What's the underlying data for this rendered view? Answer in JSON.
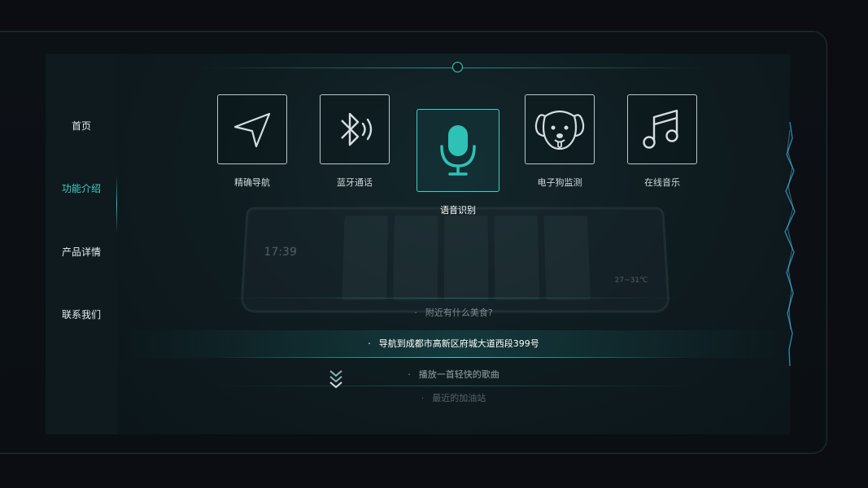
{
  "sidebar": {
    "items": [
      {
        "label": "首页"
      },
      {
        "label": "功能介绍",
        "active": true
      },
      {
        "label": "产品详情"
      },
      {
        "label": "联系我们"
      }
    ]
  },
  "features": [
    {
      "label": "精确导航",
      "icon": "navigation-arrow-icon"
    },
    {
      "label": "蓝牙通话",
      "icon": "bluetooth-call-icon"
    },
    {
      "label": "语音识别",
      "icon": "microphone-icon",
      "active": true
    },
    {
      "label": "电子狗监测",
      "icon": "dog-icon"
    },
    {
      "label": "在线音乐",
      "icon": "music-note-icon"
    }
  ],
  "prompts": [
    {
      "text": "附近有什么美食?"
    },
    {
      "text": "导航到成都市高新区府城大道西段399号",
      "highlighted": true
    },
    {
      "text": "播放一首轻快的歌曲"
    },
    {
      "text": "最近的加油站"
    }
  ],
  "device_screen": {
    "clock": "17:39",
    "weather_temp": "27~31℃"
  },
  "colors": {
    "accent": "#3fd0c4",
    "background": "#0b0d12",
    "panel": "#0e1a1e"
  }
}
